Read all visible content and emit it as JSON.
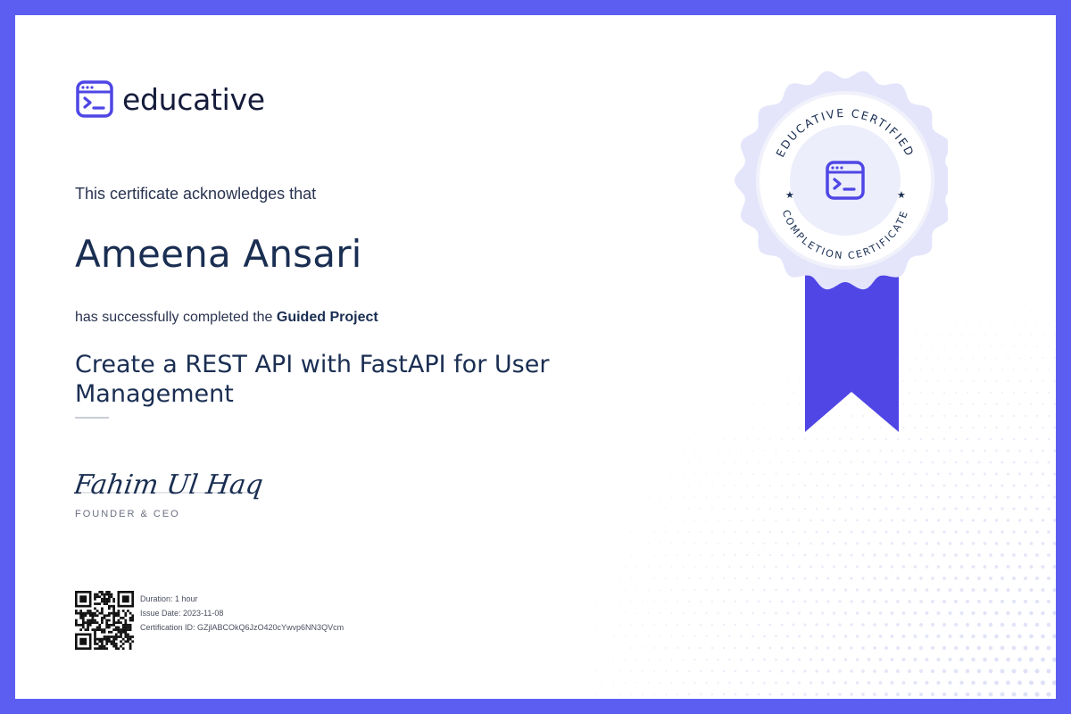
{
  "brand": {
    "name": "educative",
    "color": "#4f46e5"
  },
  "certificate": {
    "acknowledgement": "This certificate acknowledges that",
    "recipient": "Ameena Ansari",
    "completed_prefix": "has successfully completed the ",
    "project_type": "Guided Project",
    "course_title": "Create a REST API with FastAPI for User Management",
    "signature": "Fahim Ul Haq",
    "signer_title": "FOUNDER & CEO"
  },
  "details": {
    "duration": "Duration: 1 hour",
    "issue_date": "Issue Date: 2023-11-08",
    "certification_id": "Certification ID: GZjlABCOkQ6JzO420cYwvp6NN3QVcm"
  },
  "seal": {
    "top_text": "EDUCATIVE CERTIFIED",
    "bottom_text": "COMPLETION CERTIFICATE"
  },
  "colors": {
    "frame": "#5b5ef0",
    "text_dark": "#1a2e52",
    "ribbon": "#4f46e5"
  }
}
